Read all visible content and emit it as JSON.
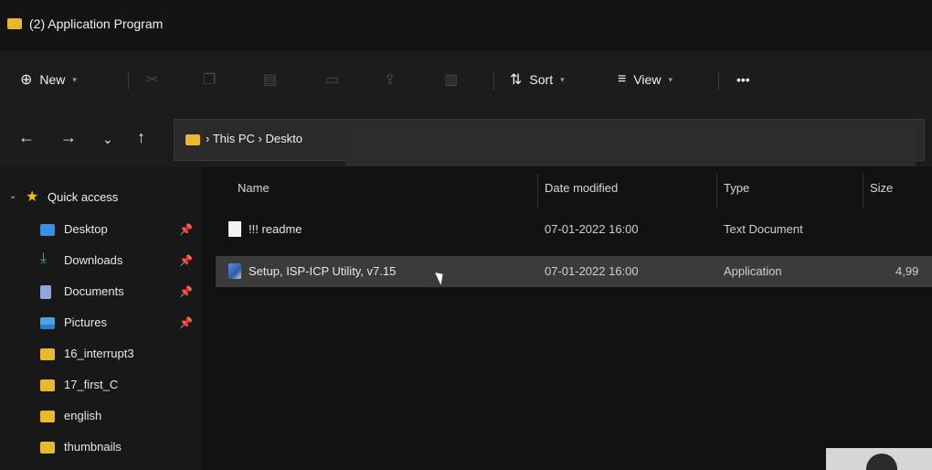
{
  "window": {
    "title": "(2) Application Program"
  },
  "toolbar": {
    "new_label": "New",
    "sort_label": "Sort",
    "view_label": "View",
    "more_label": "•••"
  },
  "address": {
    "crumbs": "› This PC › Deskto"
  },
  "sidebar": {
    "quick_access": "Quick access",
    "items": [
      {
        "label": "Desktop",
        "icon": "desktop-icon",
        "pinned": true,
        "color": "#3a8fe0"
      },
      {
        "label": "Downloads",
        "icon": "download-icon",
        "pinned": true,
        "color": "#3fb27a"
      },
      {
        "label": "Documents",
        "icon": "documents-icon",
        "pinned": true,
        "color": "#8aa8d8"
      },
      {
        "label": "Pictures",
        "icon": "pictures-icon",
        "pinned": true,
        "color": "#4aa3e8"
      },
      {
        "label": "16_interrupt3",
        "icon": "folder-icon",
        "pinned": false,
        "color": "#e8b92c"
      },
      {
        "label": "17_first_C",
        "icon": "folder-icon",
        "pinned": false,
        "color": "#e8b92c"
      },
      {
        "label": "english",
        "icon": "folder-icon",
        "pinned": false,
        "color": "#e8b92c"
      },
      {
        "label": "thumbnails",
        "icon": "folder-icon",
        "pinned": false,
        "color": "#e8b92c"
      }
    ]
  },
  "file_list": {
    "headers": {
      "name": "Name",
      "date": "Date modified",
      "type": "Type",
      "size": "Size"
    },
    "rows": [
      {
        "name": "!!! readme",
        "date": "07-01-2022 16:00",
        "type": "Text Document",
        "size": "",
        "icon": "text-file-icon",
        "selected": false
      },
      {
        "name": "Setup, ISP-ICP Utility, v7.15",
        "date": "07-01-2022 16:00",
        "type": "Application",
        "size": "4,99",
        "icon": "setup-app-icon",
        "selected": true
      }
    ]
  },
  "colors": {
    "accent_folder": "#e8b92c",
    "selection": "#3b3b3b"
  }
}
